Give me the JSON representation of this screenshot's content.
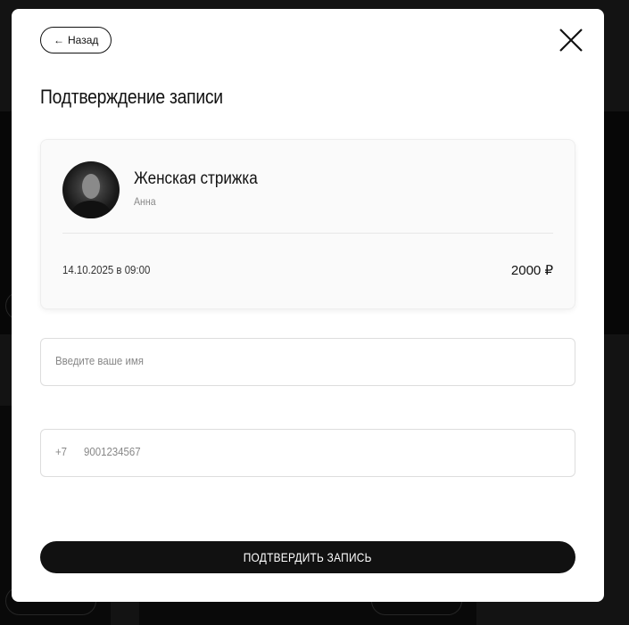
{
  "modal": {
    "back_label": "Назад",
    "back_arrow": "←",
    "title": "Подтверждение записи",
    "close_icon": "close-icon"
  },
  "booking": {
    "service": "Женская стрижка",
    "master": "Анна",
    "datetime": "14.10.2025 в 09:00",
    "price": "2000 ₽"
  },
  "form": {
    "name_placeholder": "Введите ваше имя",
    "phone_code": "+7",
    "phone_placeholder": "9001234567",
    "submit_label": "ПОДТВЕРДИТЬ ЗАПИСЬ"
  }
}
